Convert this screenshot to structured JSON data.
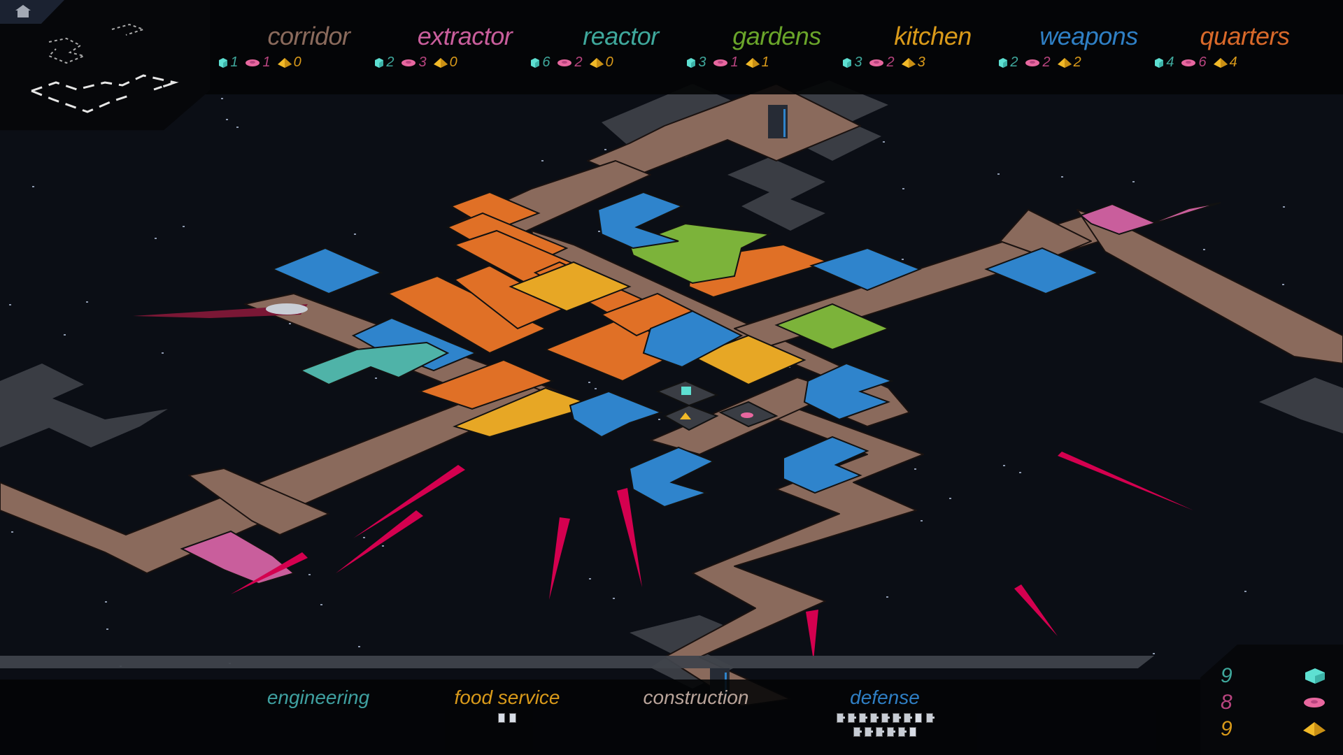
{
  "palette": {
    "background": "#0b0e15",
    "corridor": "#8a6a5c",
    "extractor": "#c95e9c",
    "reactor": "#4fb3a8",
    "gardens": "#7cb33a",
    "kitchen": "#e7a725",
    "weapons": "#2f84cc",
    "quarters": "#e07026",
    "unbuilt": "#3a3d44",
    "missile": "#d4004f",
    "res_cube": "#5ee0d2",
    "res_disc": "#e8679f",
    "res_pyramid": "#f1b928"
  },
  "top_menu": {
    "categories": [
      {
        "id": "corridor",
        "label": "corridor",
        "color": "#8a6a5c",
        "costs": {
          "cube": "1",
          "disc": "1",
          "pyramid": "0"
        }
      },
      {
        "id": "extractor",
        "label": "extractor",
        "color": "#c95e9c",
        "costs": {
          "cube": "2",
          "disc": "3",
          "pyramid": "0"
        }
      },
      {
        "id": "reactor",
        "label": "reactor",
        "color": "#3fa89c",
        "costs": {
          "cube": "6",
          "disc": "2",
          "pyramid": "0"
        }
      },
      {
        "id": "gardens",
        "label": "gardens",
        "color": "#6aa52a",
        "costs": {
          "cube": "3",
          "disc": "1",
          "pyramid": "1"
        }
      },
      {
        "id": "kitchen",
        "label": "kitchen",
        "color": "#d99a1a",
        "costs": {
          "cube": "3",
          "disc": "2",
          "pyramid": "3"
        }
      },
      {
        "id": "weapons",
        "label": "weapons",
        "color": "#2f7fc4",
        "costs": {
          "cube": "2",
          "disc": "2",
          "pyramid": "2"
        }
      },
      {
        "id": "quarters",
        "label": "quarters",
        "color": "#d9692a",
        "costs": {
          "cube": "4",
          "disc": "6",
          "pyramid": "4"
        }
      }
    ],
    "cost_colors": {
      "cube": "#3fa89c",
      "disc": "#b8447f",
      "pyramid": "#d99a1a"
    }
  },
  "departments": [
    {
      "id": "engineering",
      "label": "engineering",
      "color": "#3fa0a0",
      "units": [
        []
      ]
    },
    {
      "id": "food_service",
      "label": "food service",
      "color": "#d99a1a",
      "units": [
        [
          "plain",
          "plain"
        ]
      ]
    },
    {
      "id": "construction",
      "label": "construction",
      "color": "#b9a49a",
      "units": [
        []
      ]
    },
    {
      "id": "defense",
      "label": "defense",
      "color": "#2f7fc4",
      "units": [
        [
          "dot",
          "dot",
          "dot",
          "dot",
          "dot",
          "dot",
          "dot",
          "plain",
          "dot"
        ],
        [
          "dot",
          "dot",
          "dot",
          "dot",
          "dot",
          "plain"
        ]
      ]
    }
  ],
  "resources": [
    {
      "id": "cube",
      "value": "9",
      "color": "#3fa89c",
      "icon": "cube-icon"
    },
    {
      "id": "disc",
      "value": "8",
      "color": "#b8447f",
      "icon": "disc-icon"
    },
    {
      "id": "pyramid",
      "value": "9",
      "color": "#d99a1a",
      "icon": "pyramid-icon"
    }
  ]
}
